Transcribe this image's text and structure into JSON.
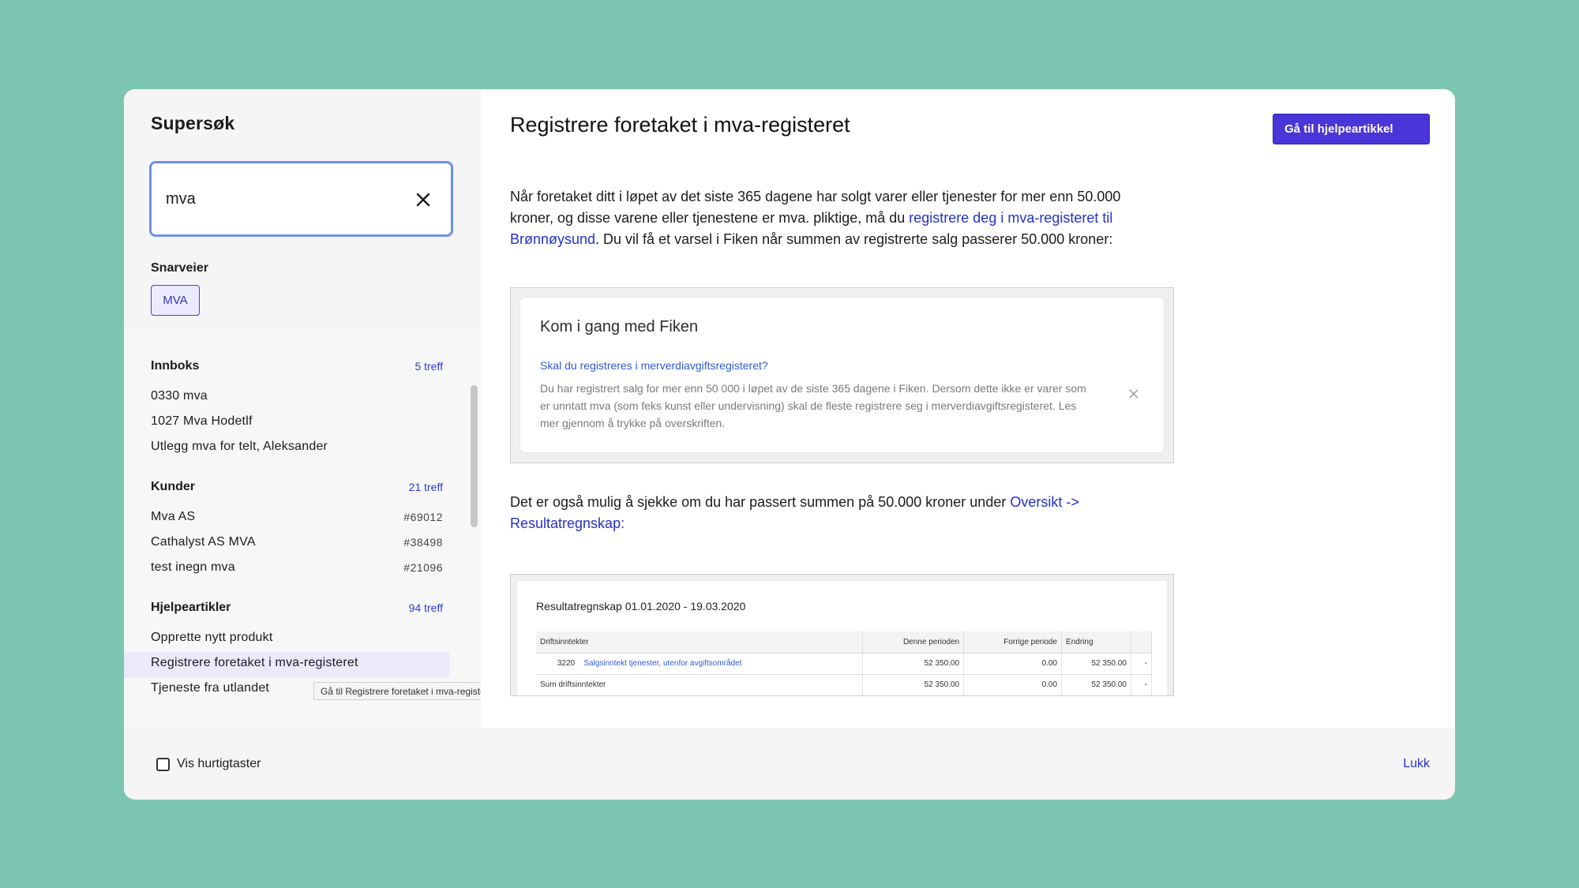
{
  "colors": {
    "background": "#7cc6b1",
    "accent": "#4a35d8",
    "link": "#2330cf",
    "search_border": "#6f8fe6"
  },
  "sidebar": {
    "title": "Supersøk",
    "search": {
      "value": "mva"
    },
    "shortcuts_label": "Snarveier",
    "shortcut_chip": "MVA",
    "sections": [
      {
        "title": "Innboks",
        "count": "5 treff",
        "items": [
          {
            "label": "0330 mva"
          },
          {
            "label": "1027 Mva Hodetlf"
          },
          {
            "label": "Utlegg mva for telt, Aleksander"
          }
        ]
      },
      {
        "title": "Kunder",
        "count": "21 treff",
        "items": [
          {
            "label": "Mva AS",
            "number": "#69012"
          },
          {
            "label": "Cathalyst AS MVA",
            "number": "#38498"
          },
          {
            "label": "test inegn mva",
            "number": "#21096"
          }
        ]
      },
      {
        "title": "Hjelpeartikler",
        "count": "94 treff",
        "items": [
          {
            "label": "Opprette nytt produkt"
          },
          {
            "label": "Registrere foretaket i mva-registeret"
          },
          {
            "label": "Tjeneste fra utlandet"
          }
        ]
      }
    ],
    "tooltip": "Gå til Registrere foretaket i mva-registeret -"
  },
  "article": {
    "title": "Registrere foretaket i mva-registeret",
    "button": "Gå til hjelpeartikkel",
    "p1_a": "Når foretaket ditt i løpet av det siste 365 dagene har solgt varer eller tjenester for mer enn 50.000 kroner, og disse varene eller tjenestene er mva. pliktige, må du ",
    "p1_link": "registrere deg i mva-registeret til Brønnøysund",
    "p1_b": ". Du vil få et varsel i Fiken når summen av registrerte salg passerer 50.000 kroner:",
    "image1": {
      "heading": "Kom i gang med Fiken",
      "link": "Skal du registreres i merverdiavgiftsregisteret?",
      "body": "Du har registrert salg for mer enn 50 000 i løpet av de siste 365 dagene i Fiken. Dersom dette ikke er varer som er unntatt mva (som feks kunst eller undervisning) skal de fleste registrere seg i merverdiavgiftsregisteret. Les mer gjennom å trykke på overskriften."
    },
    "p2_a": "Det er også mulig å sjekke om du har passert summen på 50.000 kroner under ",
    "p2_link": "Oversikt -> Resultatregnskap:",
    "image2": {
      "title": "Resultatregnskap 01.01.2020 - 19.03.2020",
      "headers": [
        "Driftsinntekter",
        "Denne perioden",
        "Forrige periode",
        "Endring",
        ""
      ],
      "row1": {
        "code": "3220",
        "account": "Salgsinntekt tjenester, utenfor avgiftsområdet",
        "current": "52 350.00",
        "previous": "0.00",
        "change": "52 350.00",
        "extra": "-"
      },
      "row2": {
        "label": "Sum driftsinntekter",
        "current": "52 350.00",
        "previous": "0.00",
        "change": "52 350.00",
        "extra": "-"
      }
    }
  },
  "footer": {
    "checkbox_label": "Vis hurtigtaster",
    "close": "Lukk"
  }
}
